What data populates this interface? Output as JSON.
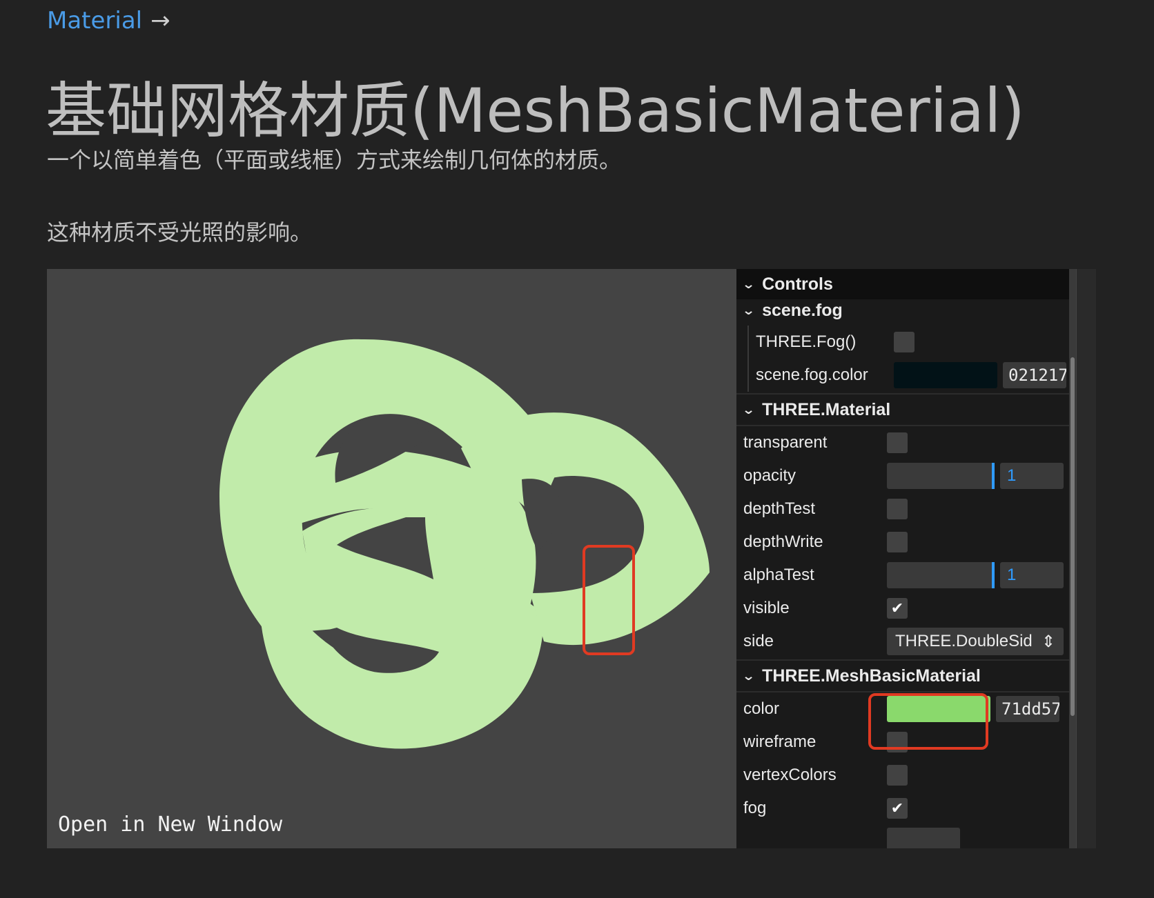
{
  "breadcrumb": {
    "link": "Material",
    "arrow": "→"
  },
  "page": {
    "title": "基础网格材质(MeshBasicMaterial)",
    "desc1": "一个以简单着色（平面或线框）方式来绘制几何体的材质。",
    "desc2": "这种材质不受光照的影响。"
  },
  "example": {
    "open_window": "Open in New Window",
    "mesh_color": "#c1ebaa",
    "background": "#444444"
  },
  "gui": {
    "header": "Controls",
    "fog": {
      "title": "scene.fog",
      "fog_label": "THREE.Fog()",
      "fog_checked": false,
      "color_label": "scene.fog.color",
      "color_hex": "021217",
      "color_swatch": "#021217"
    },
    "material": {
      "title": "THREE.Material",
      "transparent_label": "transparent",
      "transparent_checked": false,
      "opacity_label": "opacity",
      "opacity_value": "1",
      "depthTest_label": "depthTest",
      "depthTest_checked": false,
      "depthWrite_label": "depthWrite",
      "depthWrite_checked": false,
      "alphaTest_label": "alphaTest",
      "alphaTest_value": "1",
      "visible_label": "visible",
      "visible_checked": true,
      "side_label": "side",
      "side_value": "THREE.DoubleSid"
    },
    "basic": {
      "title": "THREE.MeshBasicMaterial",
      "color_label": "color",
      "color_hex": "71dd57",
      "color_swatch": "#8ad96c",
      "wireframe_label": "wireframe",
      "wireframe_checked": false,
      "vertexColors_label": "vertexColors",
      "vertexColors_checked": false,
      "fog_label": "fog",
      "fog_checked": true
    }
  },
  "icons": {
    "chevron": "chevron-down-icon",
    "check": "✔",
    "select_arrows": "⇕"
  },
  "accent_color": "#2f9bff",
  "highlight_color": "#e03a22"
}
